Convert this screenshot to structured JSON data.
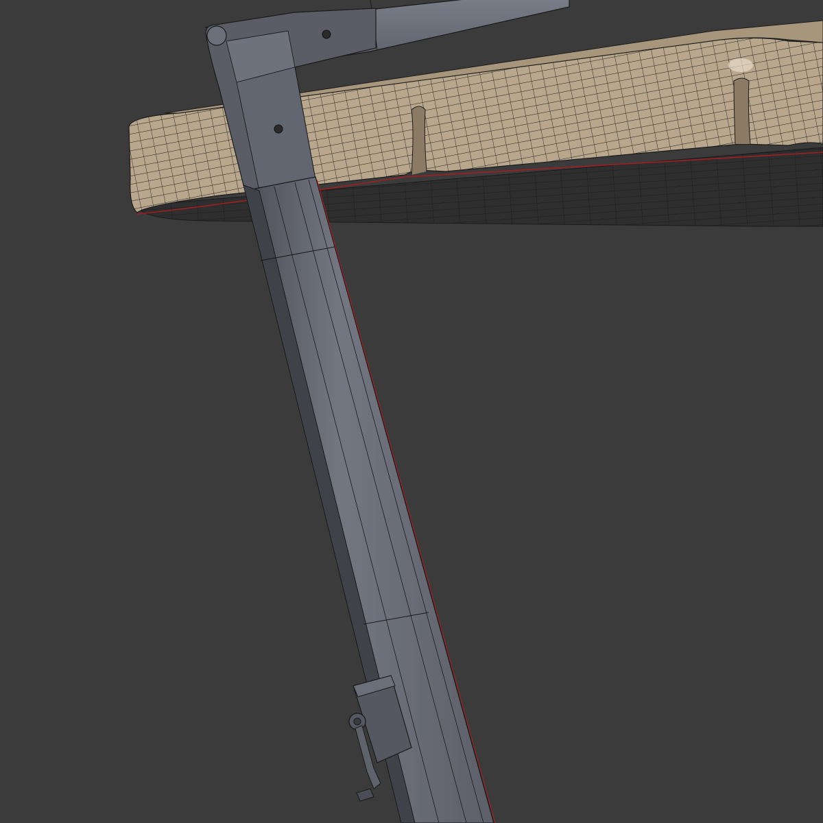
{
  "viewport": {
    "background": "#3b3b3b"
  },
  "model": {
    "cushion_color": "#b8a68c",
    "cushion_shadow_color": "#8c7c66",
    "cushion_underside_color": "#2f2f2f",
    "frame_color": "#6b6f7a",
    "frame_dark_color": "#4a4d56",
    "wire_color": "#1a1a1a",
    "edge_highlight_color": "#a02020"
  }
}
